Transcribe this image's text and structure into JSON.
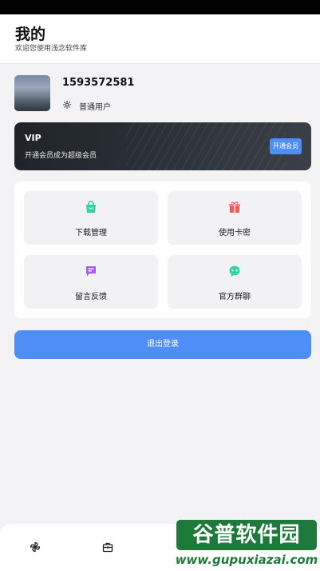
{
  "header": {
    "title": "我的",
    "subtitle": "欢迎您使用浅念软件库"
  },
  "profile": {
    "phone": "1593572581",
    "role": "普通用户"
  },
  "vip": {
    "title": "VIP",
    "desc": "开通会员成为超级会员",
    "button": "开通会员"
  },
  "menu": [
    {
      "label": "下载管理",
      "icon": "shopping-bag-icon",
      "color": "#2fd3a6"
    },
    {
      "label": "使用卡密",
      "icon": "gift-icon",
      "color": "#f05c5c"
    },
    {
      "label": "留言反馈",
      "icon": "message-icon",
      "color": "#a35ef0"
    },
    {
      "label": "官方群聊",
      "icon": "chat-bubble-icon",
      "color": "#2fd3a6"
    }
  ],
  "logout": "退出登录",
  "tabs": [
    {
      "icon": "pinwheel-icon"
    },
    {
      "icon": "toolbox-icon"
    }
  ],
  "watermark": {
    "brand": "谷普软件园",
    "url": "www.gupuxiazai.com"
  },
  "colors": {
    "accent": "#4f8ef7",
    "vip_bg": "#1f2329"
  }
}
